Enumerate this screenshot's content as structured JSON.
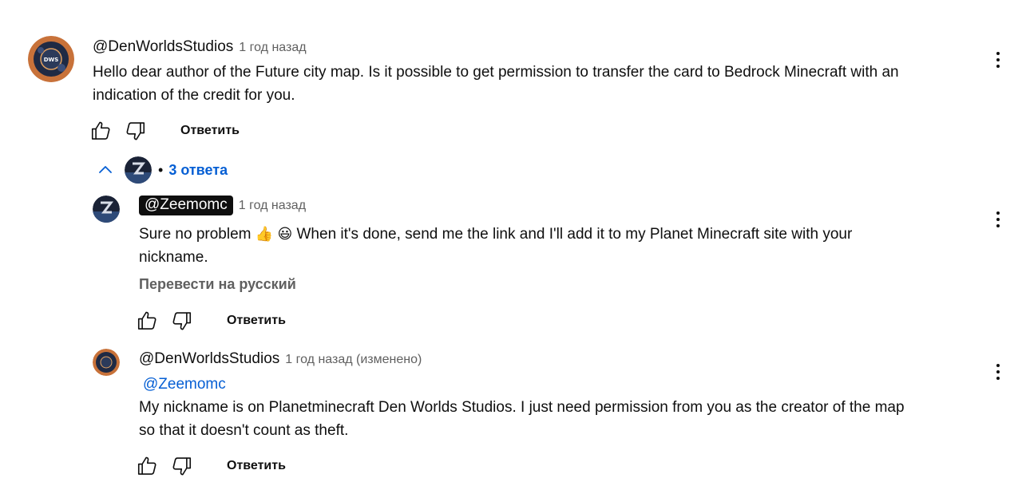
{
  "comment": {
    "author": "@DenWorldsStudios",
    "time": "1 год назад",
    "text_line1": "Hello dear author of the Future city map. Is it possible to get permission to transfer the card to Bedrock Minecraft with an",
    "text_line2": "indication of the credit for you.",
    "reply_label": "Ответить",
    "avatar_text": "DWS",
    "icons": {
      "like": "thumb-up-icon",
      "dislike": "thumb-down-icon",
      "menu": "more-vert-icon"
    }
  },
  "replies_toggle": {
    "bullet": "•",
    "label": "3 ответа",
    "icon": "chevron-up-icon"
  },
  "replies": [
    {
      "author": "@Zeemomc",
      "time": "1 год назад",
      "text_before": "Sure no problem",
      "emoji1": "👍",
      "emoji2": "😃",
      "text_after": "When it's done, send me the link and I'll add it to my Planet Minecraft site with your",
      "text_line2": "nickname.",
      "translate_label": "Перевести на русский",
      "reply_label": "Ответить"
    },
    {
      "author": "@DenWorldsStudios",
      "time": "1 год назад (изменено)",
      "mention": "@Zeemomc",
      "text_line1": "My nickname is on Planetminecraft Den Worlds Studios. I just need permission from you as the creator of the map",
      "text_line2": "so that it doesn't count as theft.",
      "reply_label": "Ответить"
    }
  ],
  "colors": {
    "link": "#065fd4",
    "secondary": "#606060",
    "text": "#0f0f0f"
  }
}
